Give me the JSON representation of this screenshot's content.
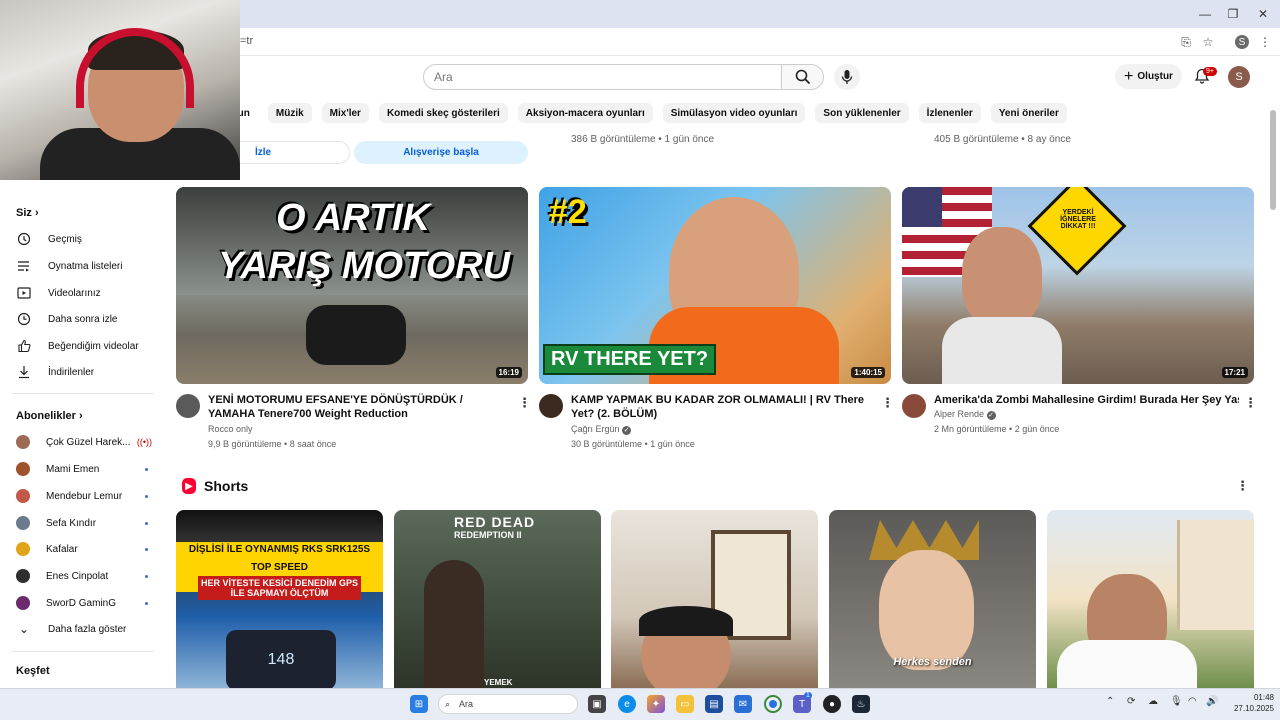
{
  "browser": {
    "url_fragment": "=tr",
    "window_controls": [
      "—",
      "❐",
      "✕"
    ],
    "profile_initial": "S"
  },
  "header": {
    "search_placeholder": "Ara",
    "create_label": "Oluştur",
    "notification_badge": "9+",
    "avatar_initial": "S"
  },
  "chips": [
    "oyun",
    "Müzik",
    "Mix'ler",
    "Komedi skeç gösterileri",
    "Aksiyon-macera oyunları",
    "Simülasyon video oyunları",
    "Son yüklenenler",
    "İzlenenler",
    "Yeni öneriler"
  ],
  "sidebar": {
    "you_label": "Siz",
    "you_items": [
      {
        "label": "Geçmiş",
        "icon": "history-icon"
      },
      {
        "label": "Oynatma listeleri",
        "icon": "playlist-icon"
      },
      {
        "label": "Videolarınız",
        "icon": "your-videos-icon"
      },
      {
        "label": "Daha sonra izle",
        "icon": "watch-later-icon"
      },
      {
        "label": "Beğendiğim videolar",
        "icon": "like-icon"
      },
      {
        "label": "İndirilenler",
        "icon": "download-icon"
      }
    ],
    "subs_label": "Abonelikler",
    "subscriptions": [
      {
        "name": "Çok Güzel Harek...",
        "live": true,
        "color": "#9b6b55"
      },
      {
        "name": "Mami Emen",
        "live": false,
        "color": "#a0522d"
      },
      {
        "name": "Mendebur Lemur",
        "live": false,
        "color": "#c2574b"
      },
      {
        "name": "Sefa Kındır",
        "live": false,
        "color": "#6b7a8f"
      },
      {
        "name": "Kafalar",
        "live": false,
        "color": "#e0a419"
      },
      {
        "name": "Enes Cinpolat",
        "live": false,
        "color": "#2f2f2f"
      },
      {
        "name": "SworD GaminG",
        "live": false,
        "color": "#6d2a6d"
      }
    ],
    "show_more": "Daha fazla göster",
    "explore_label": "Keşfet"
  },
  "previous_row": {
    "meta_1": "386 B görüntüleme • 1 gün önce",
    "meta_2": "405 B görüntüleme • 8 ay önce",
    "ad_button_1": "İzle",
    "ad_button_2": "Alışverişe başla"
  },
  "videos": [
    {
      "title": "YENİ MOTORUMU EFSANE'YE DÖNÜŞTÜRDÜK / YAMAHA Tenere700 Weight Reduction",
      "channel": "Rocco only",
      "views": "9,9 B görüntüleme • 8 saat önce",
      "duration": "16:19",
      "thumb_text_1": "O ARTIK",
      "thumb_text_2": "YARIŞ MOTORU"
    },
    {
      "title": "KAMP YAPMAK BU KADAR ZOR OLMAMALI! | RV There Yet? (2. BÖLÜM)",
      "channel": "Çağrı Ergün",
      "views": "30 B görüntüleme • 1 gün önce",
      "duration": "1:40:15",
      "thumb_text_1": "#2",
      "thumb_text_2": "RV THERE YET?"
    },
    {
      "title": "Amerika'da Zombi Mahallesine Girdim! Burada Her Şey Yasal! us",
      "channel": "Alper Rende",
      "views": "2 Mn görüntüleme • 2 gün önce",
      "duration": "17:21",
      "thumb_text_1": "YERDEKİ İĞNELERE DİKKAT !!!"
    }
  ],
  "shorts": {
    "label": "Shorts",
    "items": [
      {
        "text_1": "DİŞLİSİ İLE OYNANMIŞ RKS SRK125S",
        "text_2": "TOP SPEED",
        "text_3": "HER VİTESTE KESİCİ DENEDİM GPS İLE SAPMAYI ÖLÇTÜM",
        "readout": "148"
      },
      {
        "text_1": "RED DEAD",
        "text_2": "REDEMPTION II",
        "text_3": "YEMEK"
      },
      {},
      {
        "text_1": "Herkes senden"
      },
      {}
    ]
  },
  "taskbar": {
    "search_label": "Ara",
    "time": "01:48",
    "date": "27.10.2025",
    "badge": "1"
  }
}
